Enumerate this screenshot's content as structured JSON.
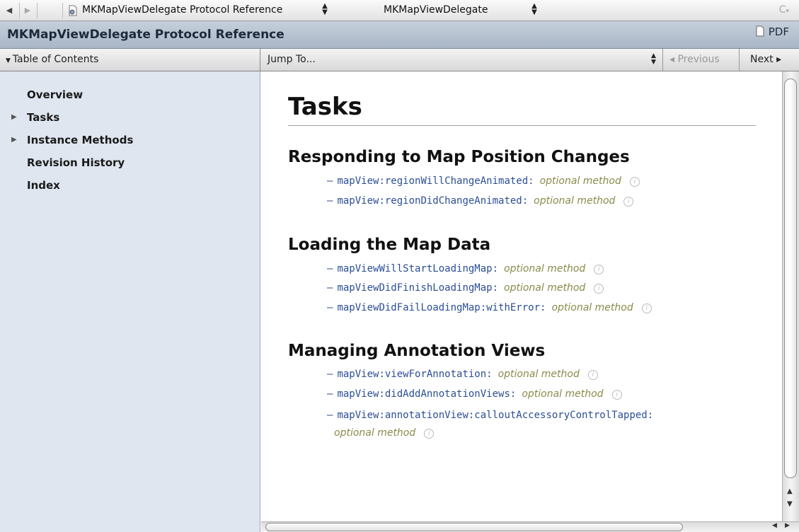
{
  "topbar": {
    "back_icon": "back-arrow-icon",
    "forward_icon": "forward-arrow-icon",
    "document_title": "MKMapViewDelegate Protocol Reference",
    "symbol_selector": "MKMapViewDelegate",
    "reload_glyph": "C"
  },
  "header": {
    "title": "MKMapViewDelegate Protocol Reference",
    "pdf_label": "PDF"
  },
  "navbar": {
    "toc_label": "Table of Contents",
    "jump_label": "Jump To...",
    "previous_label": "◂ Previous",
    "next_label": "Next ▸"
  },
  "toc": {
    "items": [
      {
        "label": "Overview",
        "expandable": false
      },
      {
        "label": "Tasks",
        "expandable": true
      },
      {
        "label": "Instance Methods",
        "expandable": true
      },
      {
        "label": "Revision History",
        "expandable": false
      },
      {
        "label": "Index",
        "expandable": false
      }
    ]
  },
  "content": {
    "heading": "Tasks",
    "optional_label": "optional method",
    "sections": [
      {
        "title": "Responding to Map Position Changes",
        "tasks": [
          "mapView:regionWillChangeAnimated:",
          "mapView:regionDidChangeAnimated:"
        ]
      },
      {
        "title": "Loading the Map Data",
        "tasks": [
          "mapViewWillStartLoadingMap:",
          "mapViewDidFinishLoadingMap:",
          "mapViewDidFailLoadingMap:withError:"
        ]
      },
      {
        "title": "Managing Annotation Views",
        "tasks": [
          "mapView:viewForAnnotation:",
          "mapView:didAddAnnotationViews:",
          "mapView:annotationView:calloutAccessoryControlTapped:"
        ]
      }
    ]
  }
}
